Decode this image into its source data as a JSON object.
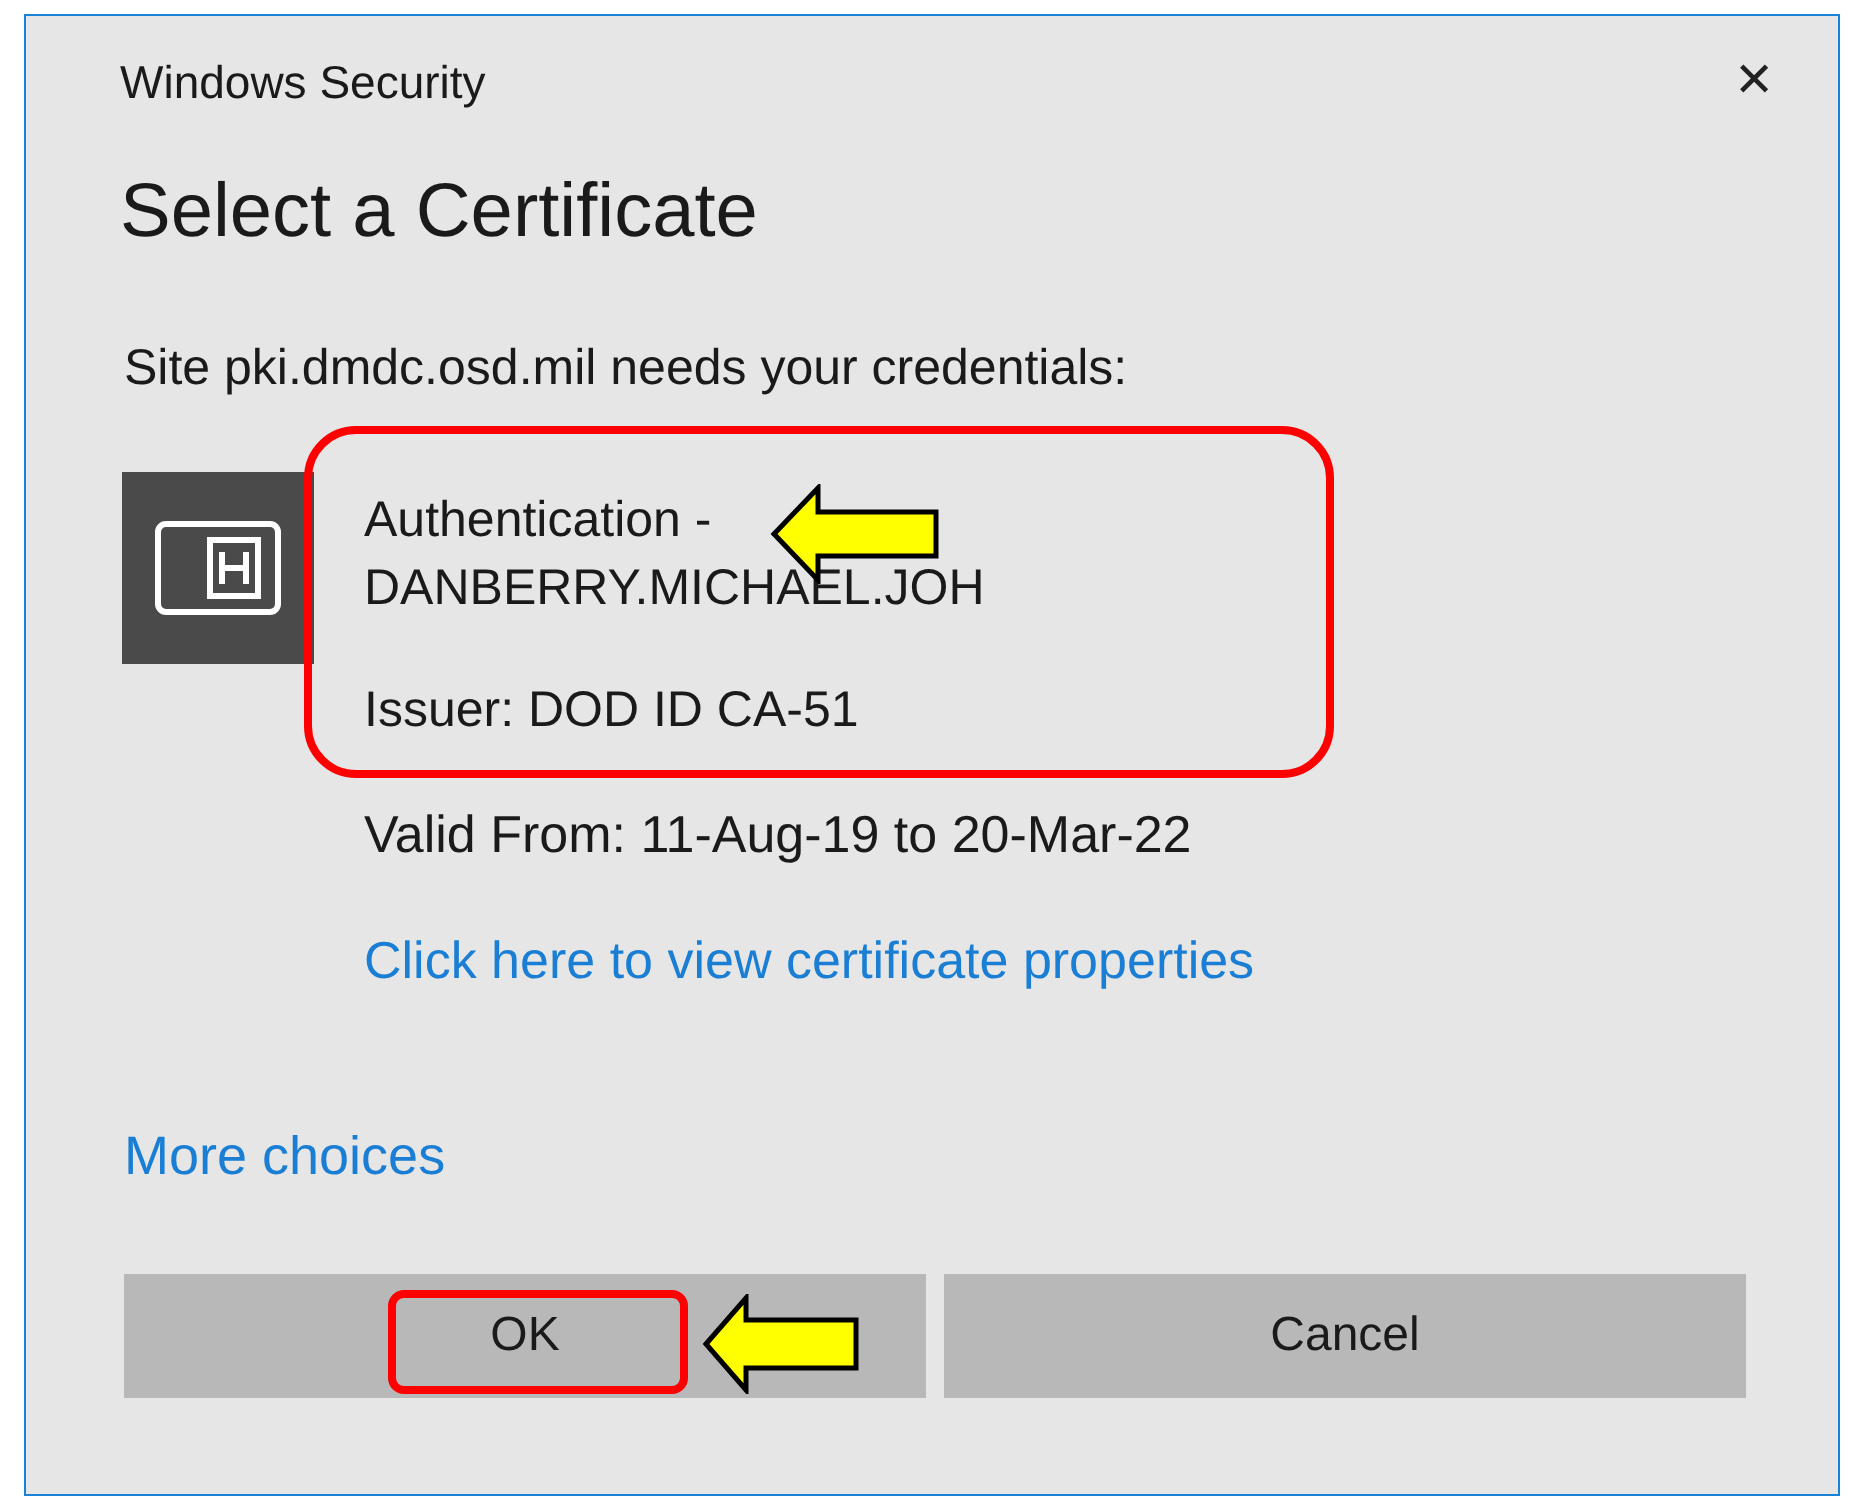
{
  "window": {
    "title": "Windows Security",
    "close": "✕"
  },
  "heading": "Select a Certificate",
  "prompt": "Site pki.dmdc.osd.mil needs your credentials:",
  "certificate": {
    "name_line_1": "Authentication -",
    "name_line_2": "DANBERRY.MICHAEL.JOH",
    "issuer": "Issuer: DOD ID CA-51",
    "validity": "Valid From: 11-Aug-19 to 20-Mar-22",
    "properties_link": "Click here to view certificate properties"
  },
  "more_choices": "More choices",
  "buttons": [
    "OK",
    "Cancel"
  ]
}
